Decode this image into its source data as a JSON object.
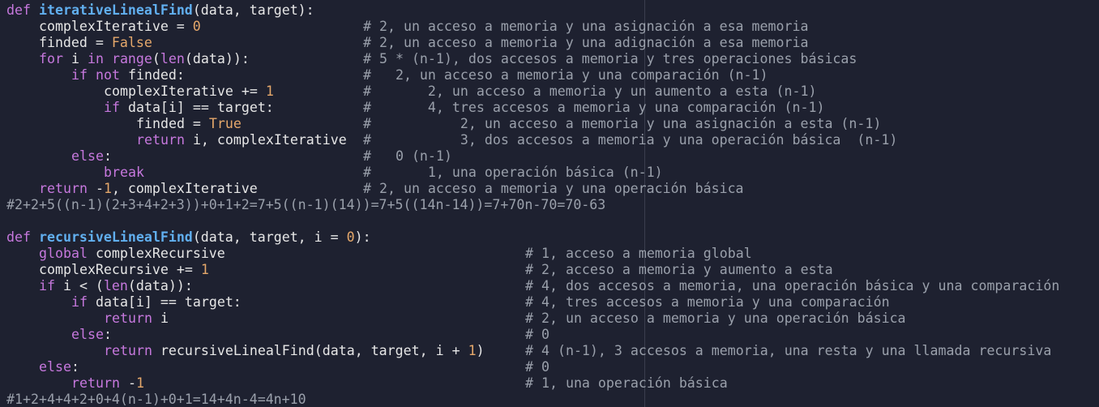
{
  "code": {
    "l1": {
      "kw": "def",
      "fn": "iterativeLinealFind",
      "rest": "(data, target):"
    },
    "l2": {
      "a": "    complexIterative = ",
      "num": "0",
      "c": "# 2, un acceso a memoria y una asignación a esa memoria"
    },
    "l3": {
      "a": "    finded = ",
      "bool": "False",
      "c": "# 2, un acceso a memoria y una adignación a esa memoria"
    },
    "l4": {
      "kw1": "for",
      "a": " i ",
      "kw2": "in",
      "sp": " ",
      "bi1": "range",
      "p1": "(",
      "bi2": "len",
      "p2": "(data)):",
      "c": "# 5 * (n-1), dos accesos a memoria y tres operaciones básicas"
    },
    "l5": {
      "kw1": "if",
      "sp": " ",
      "kw2": "not",
      "a": " finded:",
      "c": "#   2, un acceso a memoria y una comparación (n-1)"
    },
    "l6": {
      "a": "complexIterative += ",
      "num": "1",
      "c": "#       2, un acceso a memoria y un aumento a esta (n-1)"
    },
    "l7": {
      "kw": "if",
      "a": " data[i] == target:",
      "c": "#       4, tres accesos a memoria y una comparación (n-1)"
    },
    "l8": {
      "a": "finded = ",
      "bool": "True",
      "c": "#           2, un acceso a memoria y una asignación a esta (n-1)"
    },
    "l9": {
      "kw": "return",
      "a": " i, complexIterative",
      "c": "#           3, dos accesos a memoria y una operación básica  (n-1)"
    },
    "l10": {
      "kw": "else",
      "a": ":",
      "c": "#   0 (n-1)"
    },
    "l11": {
      "kw": "break",
      "c": "#       1, una operación básica (n-1)"
    },
    "l12": {
      "kw": "return",
      "a1": " -",
      "num": "1",
      "a2": ", complexIterative",
      "c": "# 2, un acceso a memoria y una operación básica"
    },
    "l13": {
      "c": "#2+2+5((n-1)(2+3+4+2+3))+0+1+2=7+5((n-1)(14))=7+5((14n-14))=7+70n-70=70-63"
    },
    "l15": {
      "kw": "def",
      "fn": "recursiveLinealFind",
      "a1": "(data, target, i = ",
      "num": "0",
      "a2": "):"
    },
    "l16": {
      "kw": "global",
      "a": " complexRecursive",
      "c": "# 1, acceso a memoria global"
    },
    "l17": {
      "a": "complexRecursive += ",
      "num": "1",
      "c": "# 2, acceso a memoria y aumento a esta"
    },
    "l18": {
      "kw": "if",
      "a1": " i < (",
      "bi": "len",
      "a2": "(data)):",
      "c": "# 4, dos accesos a memoria, una operación básica y una comparación"
    },
    "l19": {
      "kw": "if",
      "a": " data[i] == target:",
      "c": "# 4, tres accesos a memoria y una comparación"
    },
    "l20": {
      "kw": "return",
      "a": " i",
      "c": "# 2, un acceso a memoria y una operación básica"
    },
    "l21": {
      "kw": "else",
      "a": ":",
      "c": "# 0"
    },
    "l22": {
      "kw": "return",
      "a1": " recursiveLinealFind(data, target, i + ",
      "num": "1",
      "a2": ")",
      "c": "# 4 (n-1), 3 accesos a memoria, una resta y una llamada recursiva"
    },
    "l23": {
      "kw": "else",
      "a": ":",
      "c": "# 0"
    },
    "l24": {
      "kw": "return",
      "a": " -",
      "num": "1",
      "c": "# 1, una operación básica"
    },
    "l25": {
      "c": "#1+2+4+4+2+0+4(n-1)+0+1=14+4n-4=4n+10"
    }
  }
}
